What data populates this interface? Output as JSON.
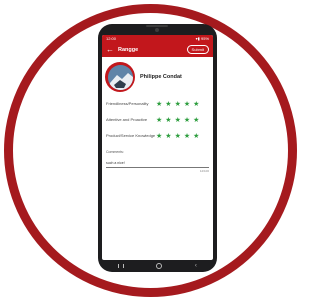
{
  "app": {
    "title": "Rangge",
    "submit_label": "Submit",
    "status_left": "12:00",
    "status_right": "▾▮ 95%"
  },
  "profile": {
    "name": "Philippe  Condat"
  },
  "ratings": [
    {
      "label": "Friendliness/Personality",
      "stars": 5
    },
    {
      "label": "Attentive and Proactive",
      "stars": 5
    },
    {
      "label": "Product/Service Knowledge",
      "stars": 5
    }
  ],
  "comments": {
    "label": "Comments:",
    "value": "such a nice!",
    "count": "12/100"
  },
  "icons": {
    "back": "arrow-left-icon",
    "star": "star-icon",
    "nav_back": "chevron-left-icon",
    "nav_home": "circle-home-icon",
    "nav_recent": "recent-apps-icon"
  },
  "colors": {
    "brand": "#c2171c",
    "ring": "#a51a1e",
    "star": "#2e9e3f"
  }
}
